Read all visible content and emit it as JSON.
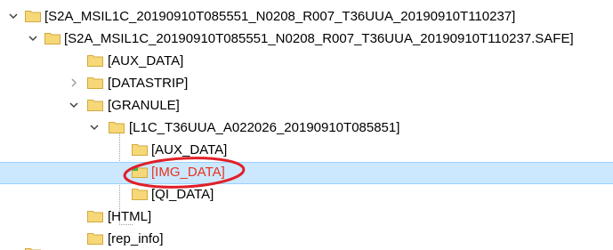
{
  "tree": {
    "items": [
      {
        "label": "[S2A_MSIL1C_20190910T085551_N0208_R007_T36UUA_20190910T110237]",
        "expand": "expanded"
      },
      {
        "label": "[S2A_MSIL1C_20190910T085551_N0208_R007_T36UUA_20190910T110237.SAFE]",
        "expand": "expanded"
      },
      {
        "label": "[AUX_DATA]",
        "expand": "none"
      },
      {
        "label": "[DATASTRIP]",
        "expand": "collapsed"
      },
      {
        "label": "[GRANULE]",
        "expand": "expanded"
      },
      {
        "label": "[L1C_T36UUA_A022026_20190910T085851]",
        "expand": "expanded"
      },
      {
        "label": "[AUX_DATA]",
        "expand": "none"
      },
      {
        "label": "[IMG_DATA]",
        "expand": "none",
        "selected": true,
        "highlighted": true
      },
      {
        "label": "[QI_DATA]",
        "expand": "none"
      },
      {
        "label": "[HTML]",
        "expand": "none"
      },
      {
        "label": "[rep_info]",
        "expand": "none"
      }
    ]
  },
  "colors": {
    "folder_fill": "#f6d879",
    "folder_stroke": "#d3a93f",
    "selection_bg": "#cce8ff",
    "annotation": "#e0202a",
    "highlight_text": "#e8301c"
  }
}
